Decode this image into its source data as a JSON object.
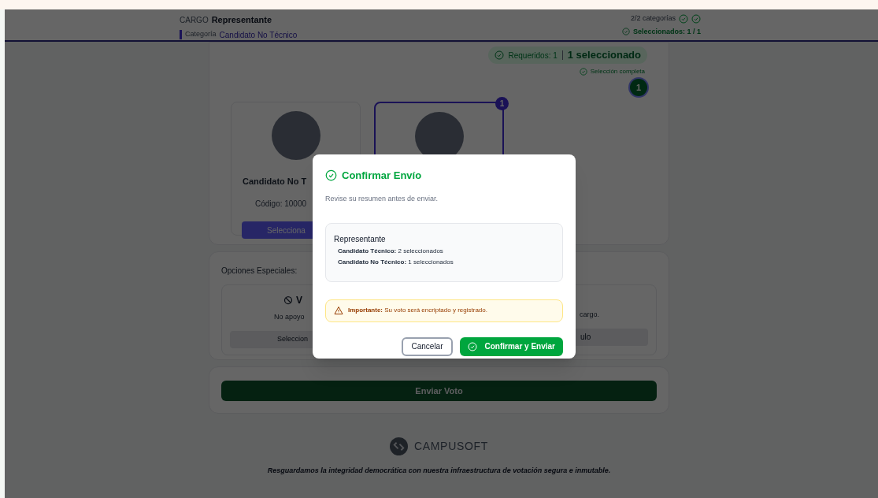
{
  "header": {
    "cargo_label": "CARGO",
    "cargo": "Representante",
    "category_label": "Categoría",
    "category": "Candidato No Técnico",
    "categories_count": "2/2 categorías",
    "selected_count": "Seleccionados: 1 / 1"
  },
  "requirement": {
    "required": "Requeridos: 1",
    "selected": "1 seleccionado",
    "status": "Selección completa",
    "count": "1"
  },
  "candidates": [
    {
      "name": "Candidato No T",
      "code": "Código: 10000",
      "button": "Selecciona",
      "selected": false
    },
    {
      "selected": true,
      "badge": "1"
    }
  ],
  "special_options": {
    "title": "Opciones Especiales:",
    "options": [
      {
        "title": "V",
        "description": "No apoyo",
        "button": "Seleccion"
      },
      {
        "description": "cargo.",
        "button": "ulo"
      }
    ]
  },
  "submit_button": "Enviar Voto",
  "footer": {
    "brand": "CAMPUSOFT",
    "tagline": "Resguardamos la integridad democrática con nuestra infraestructura de votación segura e inmutable."
  },
  "modal": {
    "title": "Confirmar Envío",
    "subtitle": "Revise su resumen antes de enviar.",
    "summary": {
      "position": "Representante",
      "lines": [
        {
          "label": "Candidato Técnico:",
          "value": "2 seleccionados"
        },
        {
          "label": "Candidato No Técnico:",
          "value": "1 seleccionados"
        }
      ]
    },
    "warning": "**Importante:** Su voto será encriptado y registrado.",
    "cancel_button": "Cancelar",
    "confirm_button": "Confirmar y Enviar"
  }
}
